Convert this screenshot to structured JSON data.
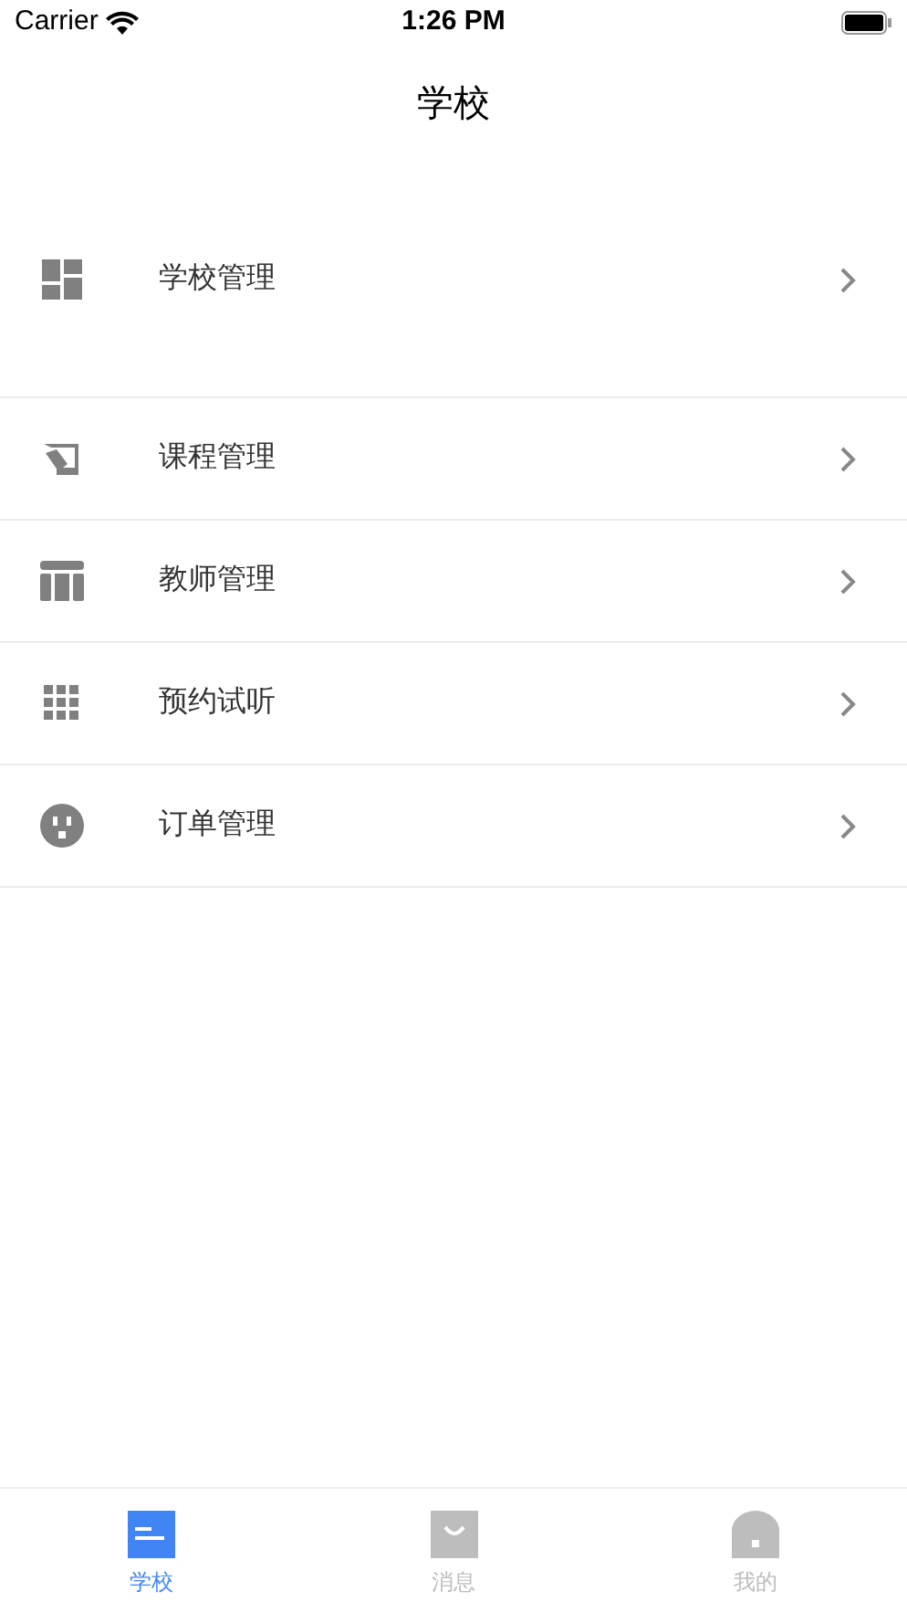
{
  "status_bar": {
    "carrier": "Carrier",
    "time": "1:26 PM"
  },
  "nav": {
    "title": "学校"
  },
  "menu": [
    {
      "kind": "dashboard",
      "label": "学校管理",
      "tall": true
    },
    {
      "kind": "course",
      "label": "课程管理",
      "tall": false
    },
    {
      "kind": "table",
      "label": "教师管理",
      "tall": false
    },
    {
      "kind": "grid",
      "label": "预约试听",
      "tall": false
    },
    {
      "kind": "face",
      "label": "订单管理",
      "tall": false
    }
  ],
  "tabs": [
    {
      "kind": "school",
      "label": "学校",
      "selected": true
    },
    {
      "kind": "message",
      "label": "消息",
      "selected": false
    },
    {
      "kind": "mine",
      "label": "我的",
      "selected": false
    }
  ]
}
